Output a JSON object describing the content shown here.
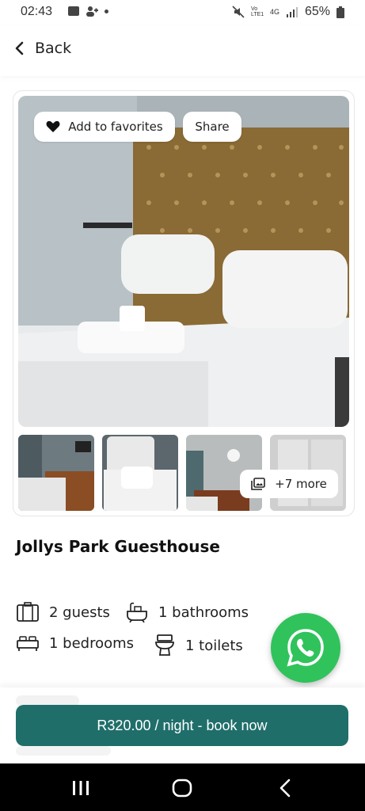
{
  "status_bar": {
    "time": "02:43",
    "battery": "65%",
    "network": "4G",
    "carrier_badge": "Vo LTE1"
  },
  "header": {
    "back_label": "Back"
  },
  "gallery": {
    "favorites_label": "Add to favorites",
    "share_label": "Share",
    "more_photos_label": "+7 more"
  },
  "listing": {
    "title": "Jollys Park Guesthouse",
    "features": {
      "guests": "2 guests",
      "bathrooms": "1 bathrooms",
      "bedrooms": "1 bedrooms",
      "toilets": "1 toilets"
    }
  },
  "booking": {
    "button_label": "R320.00 / night - book now",
    "accent_color": "#1f6e6a"
  },
  "whatsapp": {
    "color": "#30c35c",
    "icon": "whatsapp-icon"
  },
  "icons": [
    "chevron-left-icon",
    "heart-icon",
    "photo-gallery-icon",
    "luggage-icon",
    "bathtub-icon",
    "bed-icon",
    "toilet-icon",
    "whatsapp-icon"
  ]
}
